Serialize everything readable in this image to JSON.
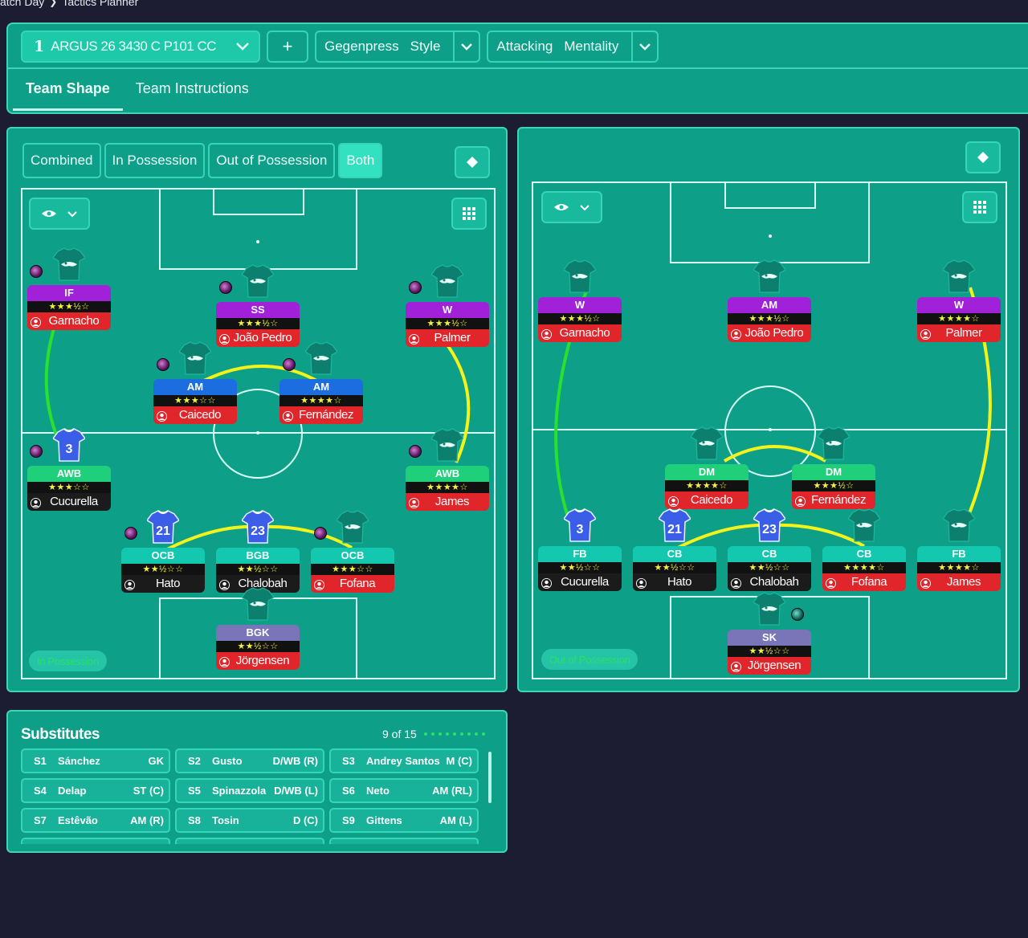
{
  "breadcrumb": {
    "items": [
      "atch Day",
      "Tactics Planner"
    ]
  },
  "top": {
    "tactic_number": "1",
    "tactic_name": "ARGUS 26 3430 C P101 CC",
    "add_label": "+",
    "style_value": "Gegenpress",
    "style_label": "Style",
    "mentality_value": "Attacking",
    "mentality_label": "Mentality"
  },
  "tabs": [
    "Team Shape",
    "Team Instructions"
  ],
  "filters": [
    "Combined",
    "In Possession",
    "Out of Possession",
    "Both"
  ],
  "phase_labels": {
    "left": "In Possession",
    "right": "Out of Possession"
  },
  "colors": {
    "background": "#1c1d33",
    "panel": "#0e9f88",
    "accent": "#3fd4b6",
    "link_green": "#29e02c",
    "link_yellow": "#f3f21a"
  },
  "in_possession": {
    "players": [
      {
        "role": "IF",
        "name": "Garnacho",
        "stars": "★★★½☆",
        "kit": ""
      },
      {
        "role": "SS",
        "name": "João Pedro",
        "stars": "★★★½☆",
        "kit": ""
      },
      {
        "role": "W",
        "name": "Palmer",
        "stars": "★★★½☆",
        "kit": ""
      },
      {
        "role": "AM",
        "name": "Caicedo",
        "stars": "★★★☆☆",
        "kit": ""
      },
      {
        "role": "AM",
        "name": "Fernández",
        "stars": "★★★★☆",
        "kit": ""
      },
      {
        "role": "AWB",
        "name": "Cucurella",
        "stars": "★★★☆☆",
        "kit": "3"
      },
      {
        "role": "AWB",
        "name": "James",
        "stars": "★★★★☆",
        "kit": ""
      },
      {
        "role": "OCB",
        "name": "Hato",
        "stars": "★★½☆☆",
        "kit": "21"
      },
      {
        "role": "BGB",
        "name": "Chalobah",
        "stars": "★★½☆☆",
        "kit": "23"
      },
      {
        "role": "OCB",
        "name": "Fofana",
        "stars": "★★★☆☆",
        "kit": ""
      },
      {
        "role": "BGK",
        "name": "Jörgensen",
        "stars": "★★½☆☆",
        "kit": ""
      }
    ]
  },
  "out_of_possession": {
    "players": [
      {
        "role": "W",
        "name": "Garnacho",
        "stars": "★★★½☆",
        "kit": ""
      },
      {
        "role": "AM",
        "name": "João Pedro",
        "stars": "★★★½☆",
        "kit": ""
      },
      {
        "role": "W",
        "name": "Palmer",
        "stars": "★★★★☆",
        "kit": ""
      },
      {
        "role": "DM",
        "name": "Caicedo",
        "stars": "★★★★☆",
        "kit": ""
      },
      {
        "role": "DM",
        "name": "Fernández",
        "stars": "★★★½☆",
        "kit": ""
      },
      {
        "role": "FB",
        "name": "Cucurella",
        "stars": "★★½☆☆",
        "kit": "3"
      },
      {
        "role": "CB",
        "name": "Hato",
        "stars": "★★½☆☆",
        "kit": "21"
      },
      {
        "role": "CB",
        "name": "Chalobah",
        "stars": "★★½☆☆",
        "kit": "23"
      },
      {
        "role": "CB",
        "name": "Fofana",
        "stars": "★★★★☆",
        "kit": ""
      },
      {
        "role": "FB",
        "name": "James",
        "stars": "★★★★☆",
        "kit": ""
      },
      {
        "role": "SK",
        "name": "Jörgensen",
        "stars": "★★½☆☆",
        "kit": ""
      }
    ]
  },
  "substitutes": {
    "title": "Substitutes",
    "count": "9 of 15",
    "items": [
      {
        "id": "S1",
        "name": "Sánchez",
        "pos": "GK"
      },
      {
        "id": "S2",
        "name": "Gusto",
        "pos": "D/WB (R)"
      },
      {
        "id": "S3",
        "name": "Andrey Santos",
        "pos": "M (C)"
      },
      {
        "id": "S4",
        "name": "Delap",
        "pos": "ST (C)"
      },
      {
        "id": "S5",
        "name": "Spinazzola",
        "pos": "D/WB (L)"
      },
      {
        "id": "S6",
        "name": "Neto",
        "pos": "AM (RL)"
      },
      {
        "id": "S7",
        "name": "Estêvão",
        "pos": "AM (R)"
      },
      {
        "id": "S8",
        "name": "Tosin",
        "pos": "D (C)"
      },
      {
        "id": "S9",
        "name": "Gittens",
        "pos": "AM (L)"
      }
    ]
  }
}
